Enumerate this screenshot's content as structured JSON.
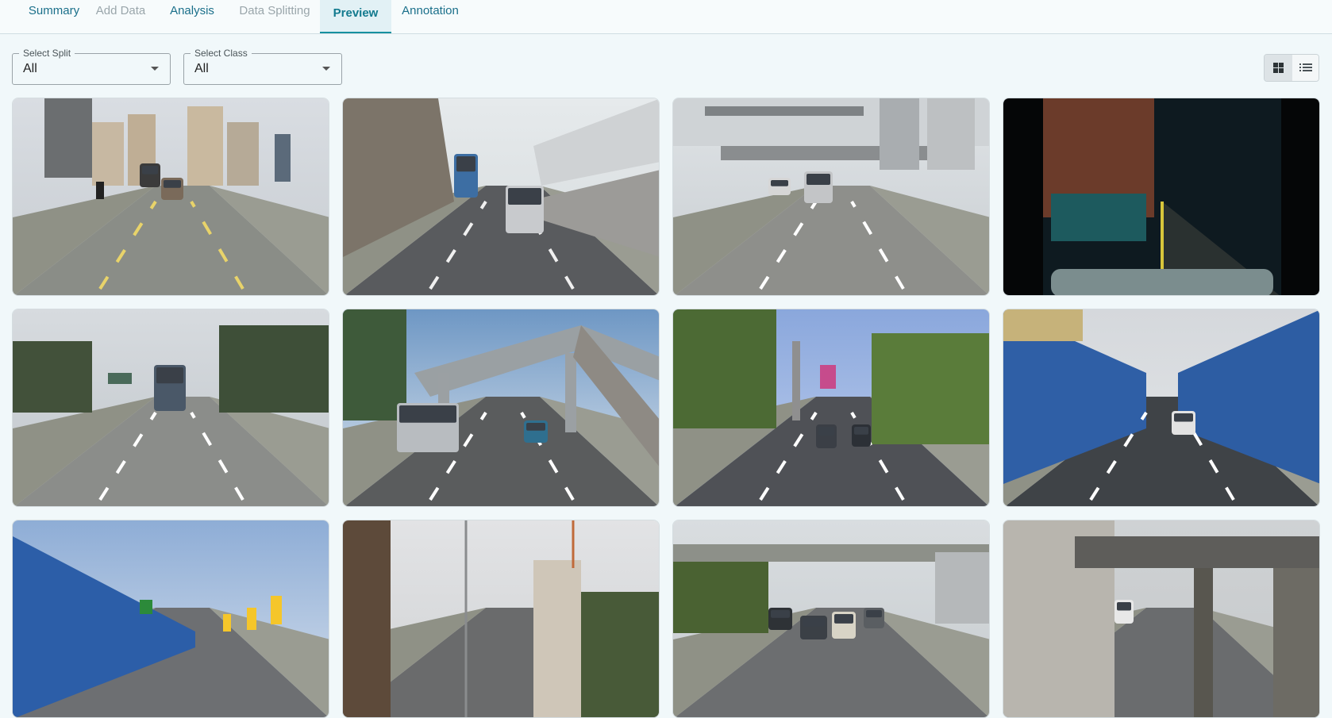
{
  "tabs": [
    {
      "label": "Summary",
      "state": "normal"
    },
    {
      "label": "Add Data",
      "state": "disabled"
    },
    {
      "label": "Analysis",
      "state": "normal"
    },
    {
      "label": "Data Splitting",
      "state": "disabled"
    },
    {
      "label": "Preview",
      "state": "active"
    },
    {
      "label": "Annotation",
      "state": "normal"
    }
  ],
  "filters": {
    "split": {
      "label": "Select Split",
      "value": "All"
    },
    "class": {
      "label": "Select Class",
      "value": "All"
    }
  },
  "view_mode": {
    "selected": "grid",
    "options": [
      "grid-icon",
      "list-icon"
    ]
  },
  "thumbnails": [
    {
      "scene": "city highway with apartment towers, truck and motorcycle",
      "theme": "day"
    },
    {
      "scene": "highway beside embankment wall, bus and silver minivan",
      "theme": "day"
    },
    {
      "scene": "highway under elevated overpass with high-rise buildings",
      "theme": "day"
    },
    {
      "scene": "night road behind a truck, dashcam blurry",
      "theme": "night"
    },
    {
      "scene": "multi-lane highway with palm trees and lorry",
      "theme": "day"
    },
    {
      "scene": "pedestrian bridge over highway with white SUV",
      "theme": "day"
    },
    {
      "scene": "tree-lined urban road with signs and cars",
      "theme": "day"
    },
    {
      "scene": "ramp between blue noise barriers, pickup truck",
      "theme": "day"
    },
    {
      "scene": "road with blue barrier and yellow chevron signs",
      "theme": "day"
    },
    {
      "scene": "road with tall building and crane",
      "theme": "day"
    },
    {
      "scene": "busy highway under flyover",
      "theme": "day"
    },
    {
      "scene": "road under concrete overpass with tiled wall",
      "theme": "day"
    }
  ]
}
